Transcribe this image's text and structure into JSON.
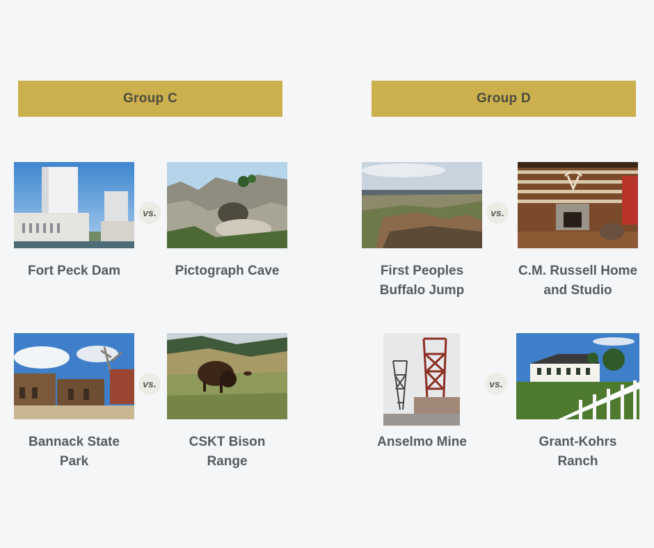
{
  "groups": [
    {
      "title": "Group C",
      "matchups": [
        {
          "left": {
            "name": "Fort Peck Dam"
          },
          "vs": "vs.",
          "right": {
            "name": "Pictograph Cave"
          }
        },
        {
          "left": {
            "name": "Bannack State Park"
          },
          "vs": "vs.",
          "right": {
            "name": "CSKT Bison Range"
          }
        }
      ]
    },
    {
      "title": "Group D",
      "matchups": [
        {
          "left": {
            "name": "First Peoples Buffalo Jump"
          },
          "vs": "vs.",
          "right": {
            "name": "C.M. Russell Home and Studio"
          }
        },
        {
          "left": {
            "name": "Anselmo Mine"
          },
          "vs": "vs.",
          "right": {
            "name": "Grant-Kohrs Ranch"
          }
        }
      ]
    }
  ],
  "colors": {
    "background": "#f5f6f8",
    "header": "#ccb04e",
    "caption": "#555a5e"
  }
}
